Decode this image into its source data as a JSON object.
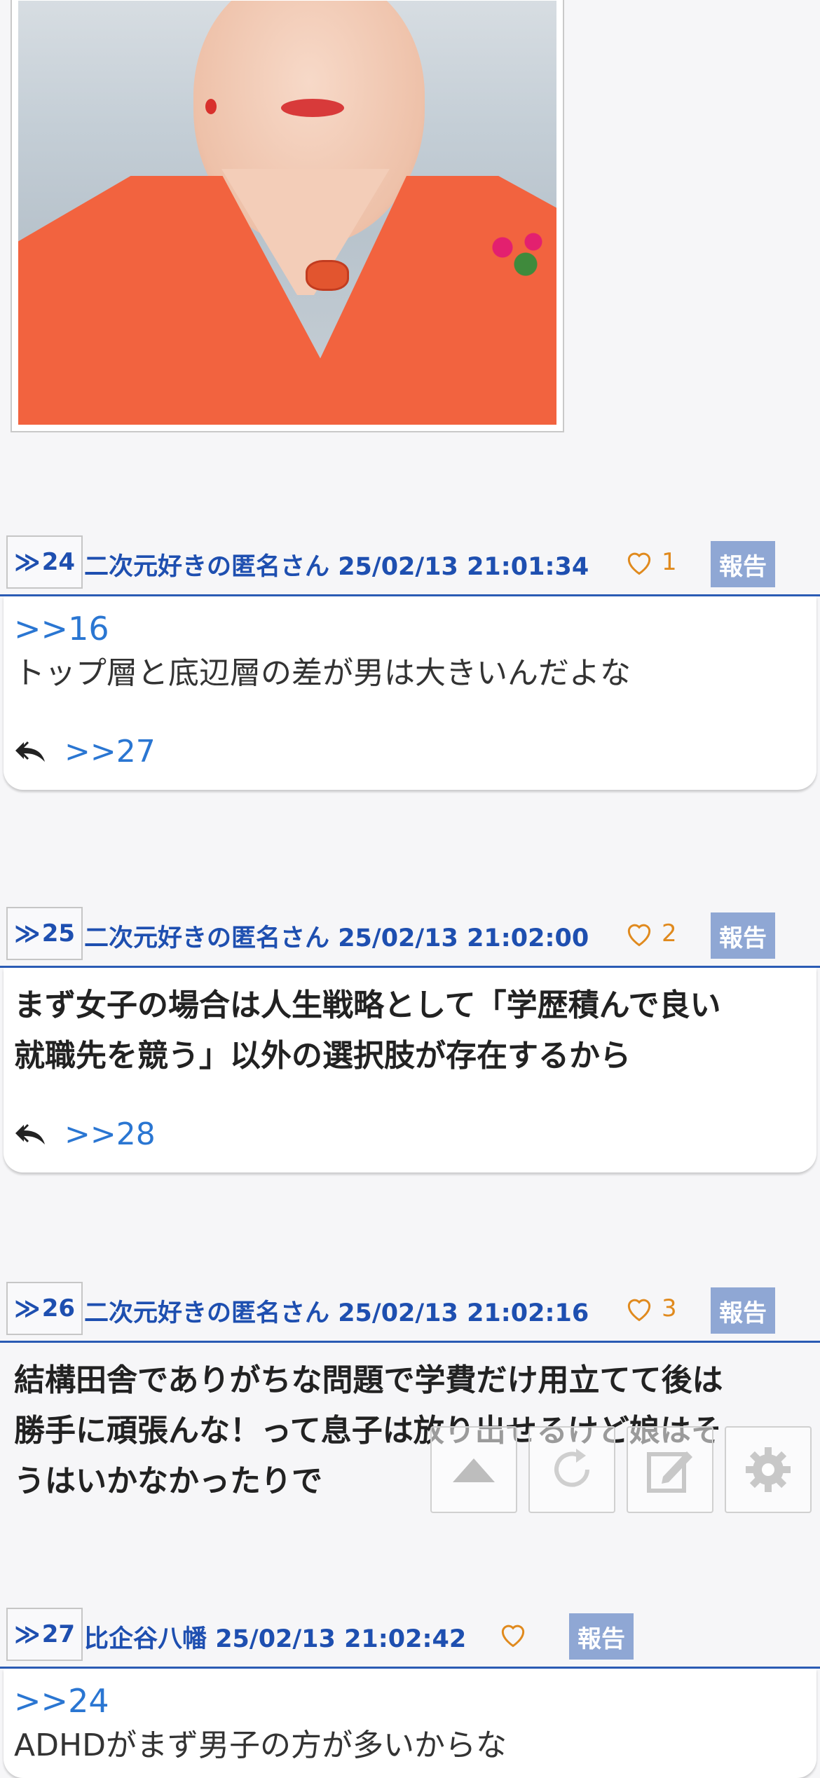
{
  "posts": [
    {
      "number": "24",
      "author": "二次元好きの匿名さん",
      "timestamp": "25/02/13 21:01:34",
      "likes": "1",
      "report_label": "報告",
      "anchor": ">>16",
      "text": "トップ層と底辺層の差が男は大きいんだよな",
      "reply_link": ">>27"
    },
    {
      "number": "25",
      "author": "二次元好きの匿名さん",
      "timestamp": "25/02/13 21:02:00",
      "likes": "2",
      "report_label": "報告",
      "text_lines": [
        "まず女子の場合は人生戦略として「学歴積んで良い",
        "就職先を競う」以外の選択肢が存在するから"
      ],
      "reply_link": ">>28"
    },
    {
      "number": "26",
      "author": "二次元好きの匿名さん",
      "timestamp": "25/02/13 21:02:16",
      "likes": "3",
      "report_label": "報告",
      "text_lines": [
        "結構田舎でありがちな問題で学費だけ用立てて後は",
        "勝手に頑張んな！って息子は放り出せるけど娘はそ",
        "うはいかなかったりで"
      ]
    },
    {
      "number": "27",
      "author": "比企谷八幡",
      "timestamp": "25/02/13 21:02:42",
      "likes": "",
      "report_label": "報告",
      "anchor": ">>24",
      "text": "ADHDがまず男子の方が多いからな"
    }
  ],
  "post_marker": "≫",
  "toolbar": [
    "scroll-top",
    "refresh",
    "compose",
    "settings"
  ]
}
